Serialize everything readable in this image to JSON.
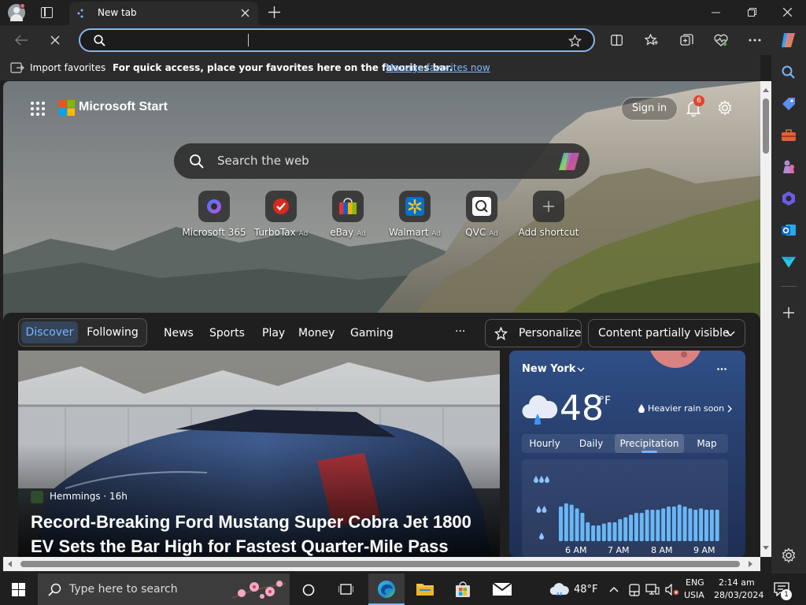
{
  "browser": {
    "tab_title": "New tab",
    "address_value": "",
    "favbar": {
      "import_label": "Import favorites",
      "hint": "For quick access, place your favorites here on the favorites bar.",
      "manage_link": "Manage favorites now"
    }
  },
  "page": {
    "brand": "Microsoft Start",
    "sign_in": "Sign in",
    "notification_count": "6",
    "search_placeholder": "Search the web",
    "shortcuts": [
      {
        "label": "Microsoft 365",
        "ad": ""
      },
      {
        "label": "TurboTax",
        "ad": "Ad"
      },
      {
        "label": "eBay",
        "ad": "Ad"
      },
      {
        "label": "Walmart",
        "ad": "Ad"
      },
      {
        "label": "QVC",
        "ad": "Ad"
      },
      {
        "label": "Add shortcut",
        "ad": ""
      }
    ],
    "feed_tabs": {
      "discover": "Discover",
      "following": "Following",
      "news": "News",
      "sports": "Sports",
      "play": "Play",
      "money": "Money",
      "gaming": "Gaming",
      "more": "···",
      "personalize": "Personalize",
      "content": "Content partially visible"
    },
    "article": {
      "source": "Hemmings · 16h",
      "headline_line1": "Record-Breaking Ford Mustang Super Cobra Jet 1800",
      "headline_line2": "EV Sets the Bar High for Fastest Quarter-Mile Pass"
    },
    "weather": {
      "location": "New York",
      "temp": "48",
      "unit": "°F",
      "alert": "Heavier rain soon",
      "tabs": [
        "Hourly",
        "Daily",
        "Precipitation",
        "Map"
      ],
      "times": [
        "6 AM",
        "7 AM",
        "8 AM",
        "9 AM"
      ],
      "precip": [
        0.55,
        0.6,
        0.58,
        0.52,
        0.45,
        0.3,
        0.25,
        0.25,
        0.28,
        0.3,
        0.3,
        0.35,
        0.38,
        0.42,
        0.45,
        0.45,
        0.5,
        0.5,
        0.5,
        0.52,
        0.55,
        0.55,
        0.58,
        0.55,
        0.52,
        0.5,
        0.52,
        0.5,
        0.5,
        0.5
      ]
    }
  },
  "taskbar": {
    "search_placeholder": "Type here to search",
    "weather": "48°F",
    "lang1": "ENG",
    "lang2": "USIA",
    "time": "2:14 am",
    "date": "28/03/2024",
    "notif": "1"
  },
  "colors": {
    "accent": "#8ab4e8",
    "link": "#82b8ff",
    "precip_bar": "#6ab7f5"
  }
}
